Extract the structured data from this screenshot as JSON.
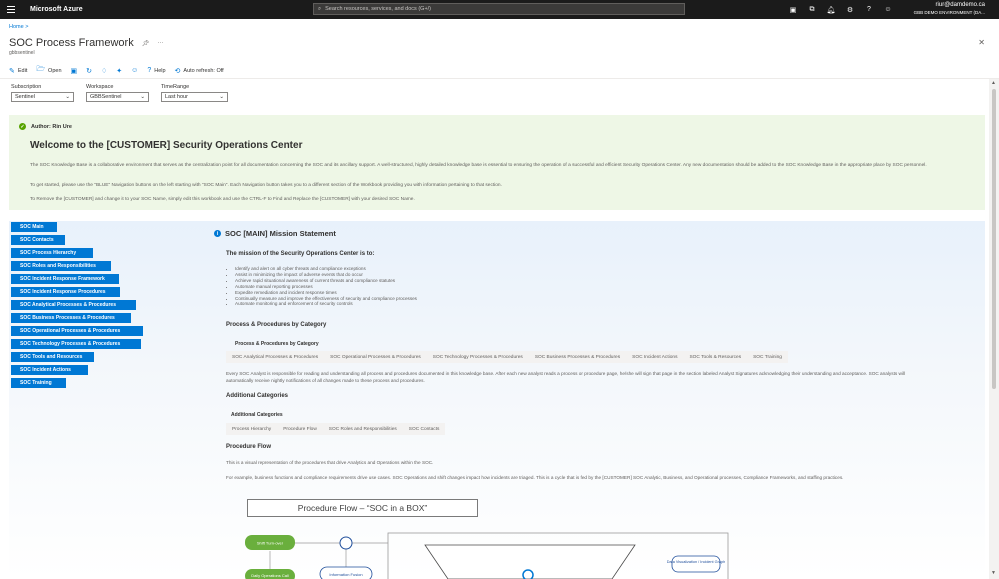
{
  "topbar": {
    "brand": "Microsoft Azure",
    "search_placeholder": "Search resources, services, and docs (G+/)",
    "account_user": "riur@damdemo.ca",
    "account_dir": "GBB DEMO ENVIRONMENT (DA...",
    "icons": [
      "cloud-shell-icon",
      "directory-icon",
      "notifications-icon",
      "settings-icon",
      "help-icon",
      "feedback-icon"
    ]
  },
  "breadcrumb": "Home >",
  "title": "SOC Process Framework",
  "subtitle": "gbbsentinel",
  "toolbar": {
    "edit": "Edit",
    "open": "Open",
    "help": "Help",
    "autorefresh": "Auto refresh: Off"
  },
  "params": [
    {
      "label": "Subscription",
      "value": "Sentinel"
    },
    {
      "label": "Workspace",
      "value": "GBBSentinel"
    },
    {
      "label": "TimeRange",
      "value": "Last hour"
    }
  ],
  "banner": {
    "author": "Author: Rin Ure",
    "heading": "Welcome to the [CUSTOMER] Security Operations Center",
    "p1": "The SOC Knowledge Base is a collaborative environment that serves as the centralization point for all documentation concerning the SOC and its ancillary support. A well-structured, highly detailed knowledge base is essential to ensuring the operation of a successful and efficient Security Operations Center. Any new documentation should be added to the SOC Knowledge Base in the appropriate place by SOC personnel.",
    "p2": "To get started, please use the \"BLUE\" Navigation buttons on the left starting with \"SOC Main\". Each Navigation button takes you to a different section of the Workbook providing you with information pertaining to that section.",
    "p3": "To Remove the [CUSTOMER] and change it to your SOC Name, simply edit this workbook and use the CTRL-F to Find and Replace the [CUSTOMER] with your desired SOC Name."
  },
  "nav": [
    "SOC Main",
    "SOC Contacts",
    "SOC Process Hierarchy",
    "SOC Roles and Responsibilities",
    "SOC Incident Response Framework",
    "SOC Incident Response Procedures",
    "SOC Analytical Processes & Procedures",
    "SOC Business Processes & Procedures",
    "SOC Operational Processes & Procedures",
    "SOC Technology Processes & Procedures",
    "SOC Tools and Resources",
    "SOC Incident Actions",
    "SOC Training"
  ],
  "mission": {
    "heading": "SOC [MAIN] Mission Statement",
    "subheading": "The mission of the Security Operations Center is to:",
    "bullets": [
      "Identify and alert on all cyber threats and compliance exceptions",
      "Assist in minimizing the impact of adverse events that do occur",
      "Achieve rapid situational awareness of current threats and compliance statutes",
      "Automate manual reporting processes",
      "Expedite remediation and incident response times",
      "Continually measure and improve the effectiveness of security and compliance processes",
      "Automate monitoring and enforcement of security controls"
    ]
  },
  "procedures": {
    "heading": "Process & Procedures by Category",
    "caption": "Process & Procedures by Category",
    "tabs": [
      "SOC Analytical Processes & Procedures",
      "SOC Operational Processes & Procedures",
      "SOC Technology Processes & Procedures",
      "SOC Business Processes & Procedures",
      "SOC Incident Actions",
      "SOC Tools & Resources",
      "SOC Training"
    ],
    "text": "Every SOC Analyst is responsible for reading and understanding all process and procedures documented in this knowledge base. After each new analyst reads a process or procedure page, he/she will sign that page in the section labeled Analyst Signatures acknowledging their understanding and acceptance. SOC analysts will automatically receive nightly notifications of all changes made to these process and procedures."
  },
  "additional": {
    "heading": "Additional Categories",
    "caption": "Additional Categories",
    "tabs": [
      "Process Hierarchy",
      "Procedure Flow",
      "SOC Roles and Responsibilities",
      "SOC Contacts"
    ]
  },
  "flow": {
    "heading": "Procedure Flow",
    "p1": "This is a visual representation of the procedures that drive Analytics and Operations within the SOC.",
    "p2": "For example, business functions and compliance requirements drive use cases. SOC Operations and shift changes impact how incidents are triaged. This is a cycle that is fed by the [CUSTOMER] SOC Analytic, Business, and Operational processes, Compliance Frameworks, and staffing practices.",
    "diagram_title": "Procedure Flow – “SOC in a BOX”",
    "nodes": {
      "shift": "Shift Turn-over",
      "daily": "Daily Operations Call",
      "fusion": "Information Fusion",
      "dataviz": "Data Visualization / Incident Graph"
    }
  }
}
